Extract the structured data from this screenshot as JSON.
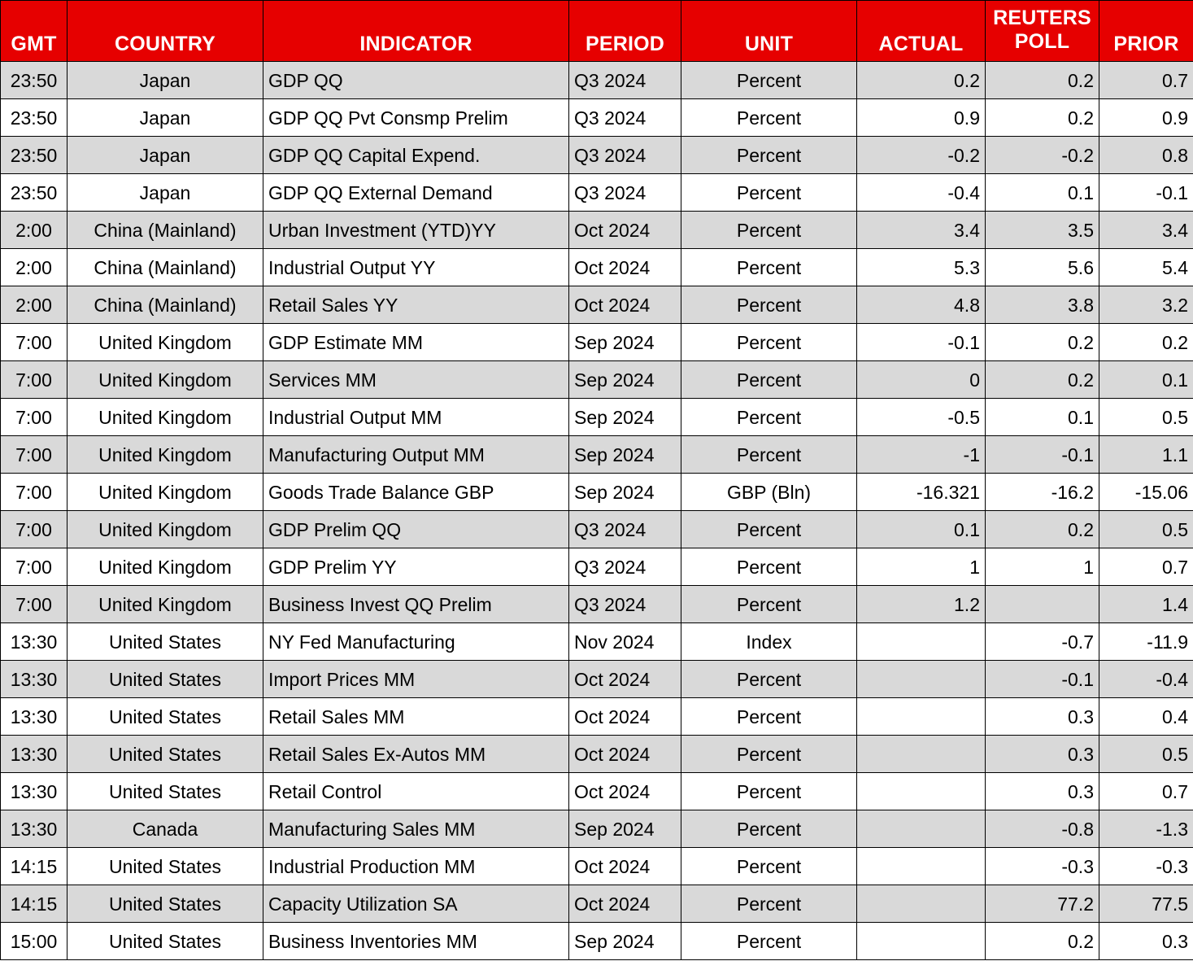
{
  "table": {
    "columns": [
      {
        "key": "gmt",
        "label": "GMT",
        "align": "a-center"
      },
      {
        "key": "country",
        "label": "COUNTRY",
        "align": "a-center"
      },
      {
        "key": "indicator",
        "label": "INDICATOR",
        "align": "a-left"
      },
      {
        "key": "period",
        "label": "PERIOD",
        "align": "a-left"
      },
      {
        "key": "unit",
        "label": "UNIT",
        "align": "a-center"
      },
      {
        "key": "actual",
        "label": "ACTUAL",
        "align": "a-right"
      },
      {
        "key": "poll",
        "label": "REUTERS POLL",
        "align": "a-right"
      },
      {
        "key": "prior",
        "label": "PRIOR",
        "align": "a-right"
      }
    ],
    "header_bg": "#E60000",
    "header_fg": "#FFFFFF",
    "row_alt_bg": "#D9D9D9",
    "row_bg": "#FFFFFF",
    "border_color": "#000000",
    "rows": [
      {
        "gmt": "23:50",
        "country": "Japan",
        "indicator": "GDP QQ",
        "period": "Q3 2024",
        "unit": "Percent",
        "actual": "0.2",
        "poll": "0.2",
        "prior": "0.7"
      },
      {
        "gmt": "23:50",
        "country": "Japan",
        "indicator": "GDP QQ Pvt Consmp Prelim",
        "period": "Q3 2024",
        "unit": "Percent",
        "actual": "0.9",
        "poll": "0.2",
        "prior": "0.9"
      },
      {
        "gmt": "23:50",
        "country": "Japan",
        "indicator": "GDP QQ Capital Expend.",
        "period": "Q3 2024",
        "unit": "Percent",
        "actual": "-0.2",
        "poll": "-0.2",
        "prior": "0.8"
      },
      {
        "gmt": "23:50",
        "country": "Japan",
        "indicator": "GDP QQ External Demand",
        "period": "Q3 2024",
        "unit": "Percent",
        "actual": "-0.4",
        "poll": "0.1",
        "prior": "-0.1"
      },
      {
        "gmt": "2:00",
        "country": "China (Mainland)",
        "indicator": "Urban Investment (YTD)YY",
        "period": "Oct 2024",
        "unit": "Percent",
        "actual": "3.4",
        "poll": "3.5",
        "prior": "3.4"
      },
      {
        "gmt": "2:00",
        "country": "China (Mainland)",
        "indicator": "Industrial Output YY",
        "period": "Oct 2024",
        "unit": "Percent",
        "actual": "5.3",
        "poll": "5.6",
        "prior": "5.4"
      },
      {
        "gmt": "2:00",
        "country": "China (Mainland)",
        "indicator": "Retail Sales YY",
        "period": "Oct 2024",
        "unit": "Percent",
        "actual": "4.8",
        "poll": "3.8",
        "prior": "3.2"
      },
      {
        "gmt": "7:00",
        "country": "United Kingdom",
        "indicator": "GDP Estimate MM",
        "period": "Sep 2024",
        "unit": "Percent",
        "actual": "-0.1",
        "poll": "0.2",
        "prior": "0.2"
      },
      {
        "gmt": "7:00",
        "country": "United Kingdom",
        "indicator": "Services MM",
        "period": "Sep 2024",
        "unit": "Percent",
        "actual": "0",
        "poll": "0.2",
        "prior": "0.1"
      },
      {
        "gmt": "7:00",
        "country": "United Kingdom",
        "indicator": "Industrial Output MM",
        "period": "Sep 2024",
        "unit": "Percent",
        "actual": "-0.5",
        "poll": "0.1",
        "prior": "0.5"
      },
      {
        "gmt": "7:00",
        "country": "United Kingdom",
        "indicator": "Manufacturing Output MM",
        "period": "Sep 2024",
        "unit": "Percent",
        "actual": "-1",
        "poll": "-0.1",
        "prior": "1.1"
      },
      {
        "gmt": "7:00",
        "country": "United Kingdom",
        "indicator": "Goods Trade Balance GBP",
        "period": "Sep 2024",
        "unit": "GBP (Bln)",
        "actual": "-16.321",
        "poll": "-16.2",
        "prior": "-15.06"
      },
      {
        "gmt": "7:00",
        "country": "United Kingdom",
        "indicator": "GDP Prelim QQ",
        "period": "Q3 2024",
        "unit": "Percent",
        "actual": "0.1",
        "poll": "0.2",
        "prior": "0.5"
      },
      {
        "gmt": "7:00",
        "country": "United Kingdom",
        "indicator": "GDP Prelim YY",
        "period": "Q3 2024",
        "unit": "Percent",
        "actual": "1",
        "poll": "1",
        "prior": "0.7"
      },
      {
        "gmt": "7:00",
        "country": "United Kingdom",
        "indicator": "Business Invest QQ Prelim",
        "period": "Q3 2024",
        "unit": "Percent",
        "actual": "1.2",
        "poll": "",
        "prior": "1.4"
      },
      {
        "gmt": "13:30",
        "country": "United States",
        "indicator": "NY Fed Manufacturing",
        "period": "Nov 2024",
        "unit": "Index",
        "actual": "",
        "poll": "-0.7",
        "prior": "-11.9"
      },
      {
        "gmt": "13:30",
        "country": "United States",
        "indicator": "Import Prices MM",
        "period": "Oct 2024",
        "unit": "Percent",
        "actual": "",
        "poll": "-0.1",
        "prior": "-0.4"
      },
      {
        "gmt": "13:30",
        "country": "United States",
        "indicator": "Retail Sales MM",
        "period": "Oct 2024",
        "unit": "Percent",
        "actual": "",
        "poll": "0.3",
        "prior": "0.4"
      },
      {
        "gmt": "13:30",
        "country": "United States",
        "indicator": "Retail Sales Ex-Autos MM",
        "period": "Oct 2024",
        "unit": "Percent",
        "actual": "",
        "poll": "0.3",
        "prior": "0.5"
      },
      {
        "gmt": "13:30",
        "country": "United States",
        "indicator": "Retail Control",
        "period": "Oct 2024",
        "unit": "Percent",
        "actual": "",
        "poll": "0.3",
        "prior": "0.7"
      },
      {
        "gmt": "13:30",
        "country": "Canada",
        "indicator": "Manufacturing Sales MM",
        "period": "Sep 2024",
        "unit": "Percent",
        "actual": "",
        "poll": "-0.8",
        "prior": "-1.3"
      },
      {
        "gmt": "14:15",
        "country": "United States",
        "indicator": "Industrial Production MM",
        "period": "Oct 2024",
        "unit": "Percent",
        "actual": "",
        "poll": "-0.3",
        "prior": "-0.3"
      },
      {
        "gmt": "14:15",
        "country": "United States",
        "indicator": "Capacity Utilization SA",
        "period": "Oct 2024",
        "unit": "Percent",
        "actual": "",
        "poll": "77.2",
        "prior": "77.5"
      },
      {
        "gmt": "15:00",
        "country": "United States",
        "indicator": "Business Inventories MM",
        "period": "Sep 2024",
        "unit": "Percent",
        "actual": "",
        "poll": "0.2",
        "prior": "0.3"
      }
    ]
  }
}
